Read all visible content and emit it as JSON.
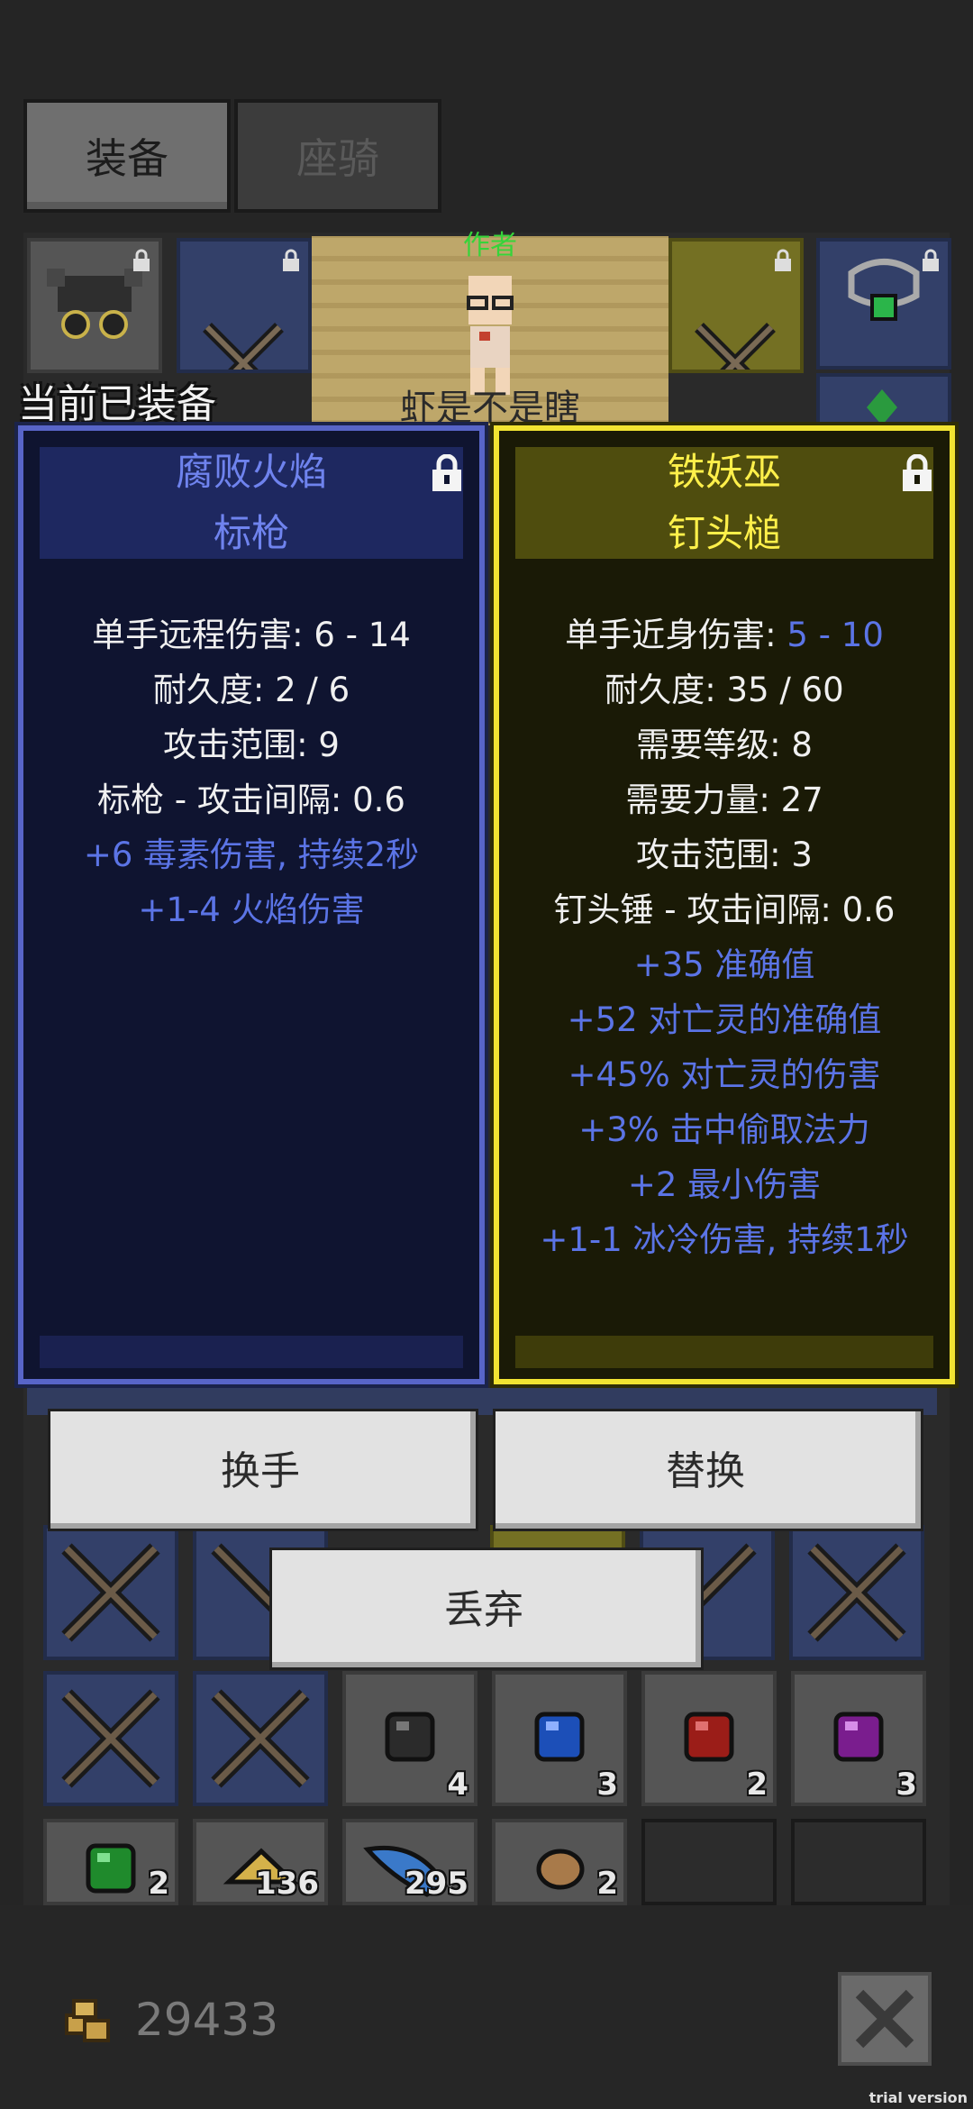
{
  "tabs": [
    {
      "label": "装备",
      "active": true
    },
    {
      "label": "座骑",
      "active": false
    }
  ],
  "scene": {
    "name_label": "作者",
    "chat_text": "虾是不是瞎"
  },
  "section_title": "当前已装备",
  "cards": {
    "left": {
      "name_line1": "腐败火焰",
      "name_line2": "标枪",
      "accent_color": "#5865c8",
      "stats": [
        "单手远程伤害: 6 - 14",
        "耐久度: 2 / 6",
        "攻击范围: 9",
        "标枪 - 攻击间隔: 0.6"
      ],
      "bonuses": [
        "+6 毒素伤害, 持续2秒",
        "+1-4 火焰伤害"
      ]
    },
    "right": {
      "name_line1": "铁妖巫",
      "name_line2": "钉头槌",
      "accent_color": "#f2e432",
      "damage_label": "单手近身伤害: ",
      "damage_value": "5 - 10",
      "stats": [
        "耐久度: 35 / 60",
        "需要等级: 8",
        "需要力量: 27",
        "攻击范围: 3",
        "钉头锤 - 攻击间隔: 0.6"
      ],
      "bonuses": [
        "+35 准确值",
        "+52 对亡灵的准确值",
        "+45% 对亡灵的伤害",
        "+3% 击中偷取法力",
        "+2 最小伤害",
        "+1-1 冰冷伤害, 持续1秒"
      ]
    }
  },
  "buttons": {
    "swap_hand": "换手",
    "replace": "替换",
    "discard": "丢弃"
  },
  "inventory_counts": [
    "4",
    "3",
    "2",
    "3",
    "2",
    "136",
    "295",
    "2"
  ],
  "gold": "29433",
  "watermark": "trial version"
}
